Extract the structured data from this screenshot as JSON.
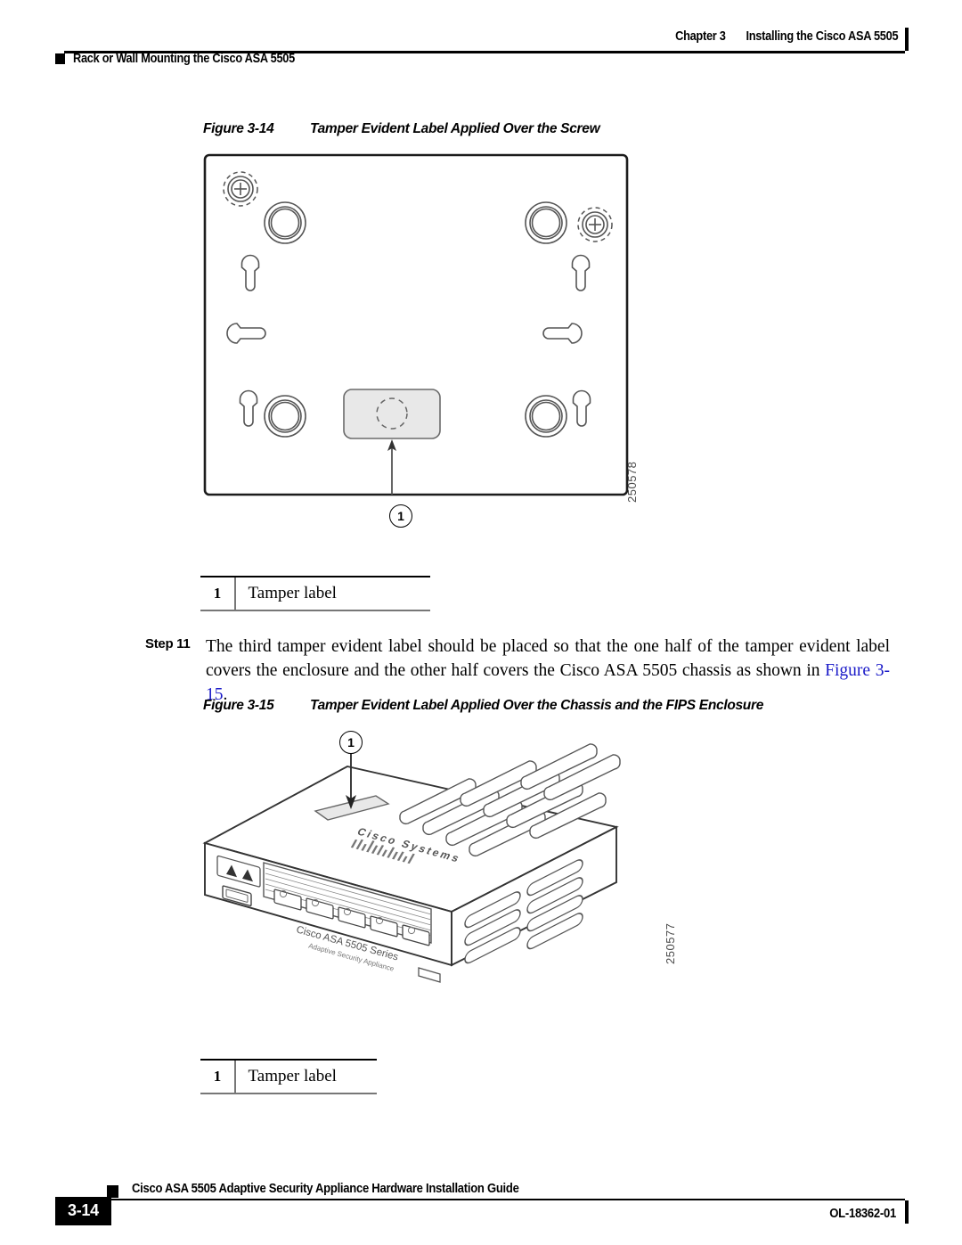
{
  "header": {
    "chapter": "Chapter 3",
    "chapter_title": "Installing the Cisco ASA 5505",
    "section_title": "Rack or Wall Mounting the Cisco ASA 5505"
  },
  "figure_314": {
    "number": "Figure 3-14",
    "title": "Tamper Evident Label Applied Over the Screw",
    "art_id": "250578",
    "callout": "1",
    "legend": {
      "number": "1",
      "label": "Tamper label"
    }
  },
  "step_11": {
    "tag": "Step 11",
    "text_part1": "The third tamper evident label should be placed so that the one half of the tamper evident label covers the enclosure and the other half covers the Cisco ASA 5505 chassis as shown in ",
    "xref": "Figure 3-15",
    "text_part2": "."
  },
  "figure_315": {
    "number": "Figure 3-15",
    "title": "Tamper Evident Label Applied Over the Chassis and the FIPS Enclosure",
    "art_id": "250577",
    "callout": "1",
    "chassis_logo": "Cisco Systems",
    "chassis_model": "Cisco ASA 5505 Series",
    "chassis_subtitle": "Adaptive Security Appliance",
    "legend": {
      "number": "1",
      "label": "Tamper label"
    }
  },
  "footer": {
    "guide_title": "Cisco ASA 5505 Adaptive Security Appliance Hardware Installation Guide",
    "page_number": "3-14",
    "doc_number": "OL-18362-01"
  },
  "colors": {
    "xref": "#1a1ac8",
    "tamper_label_fill": "#e8e8e8",
    "line": "#4a4a4a",
    "art_id": "#4a4a4a"
  }
}
